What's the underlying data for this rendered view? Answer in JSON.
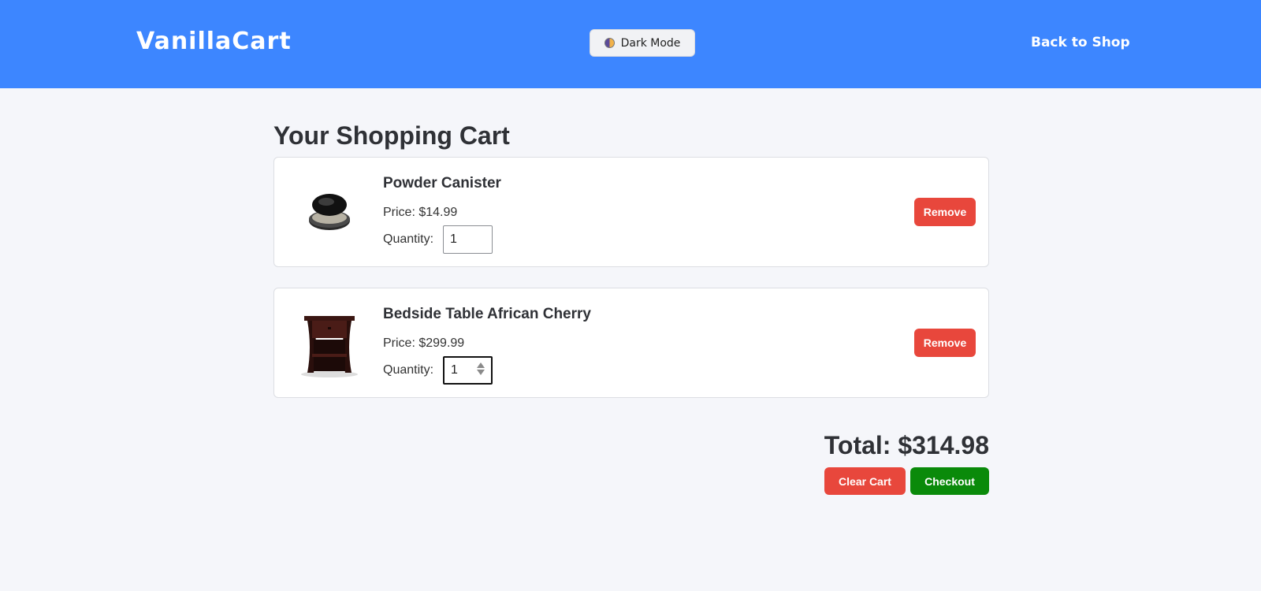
{
  "header": {
    "brand": "VanillaCart",
    "dark_mode_label": "Dark Mode",
    "back_link": "Back to Shop"
  },
  "main": {
    "title": "Your Shopping Cart",
    "price_prefix": "Price:",
    "quantity_label": "Quantity:",
    "remove_label": "Remove",
    "items": [
      {
        "name": "Powder Canister",
        "price": "$14.99",
        "quantity": "1"
      },
      {
        "name": "Bedside Table African Cherry",
        "price": "$299.99",
        "quantity": "1"
      }
    ],
    "total_text": "Total: $314.98",
    "clear_label": "Clear Cart",
    "checkout_label": "Checkout"
  },
  "colors": {
    "header_bg": "#3d86ff",
    "danger": "#e8473c",
    "success": "#0a8a0a",
    "page_bg": "#f5f6fa"
  },
  "icons": {
    "dark_mode": "half-moon-icon"
  }
}
